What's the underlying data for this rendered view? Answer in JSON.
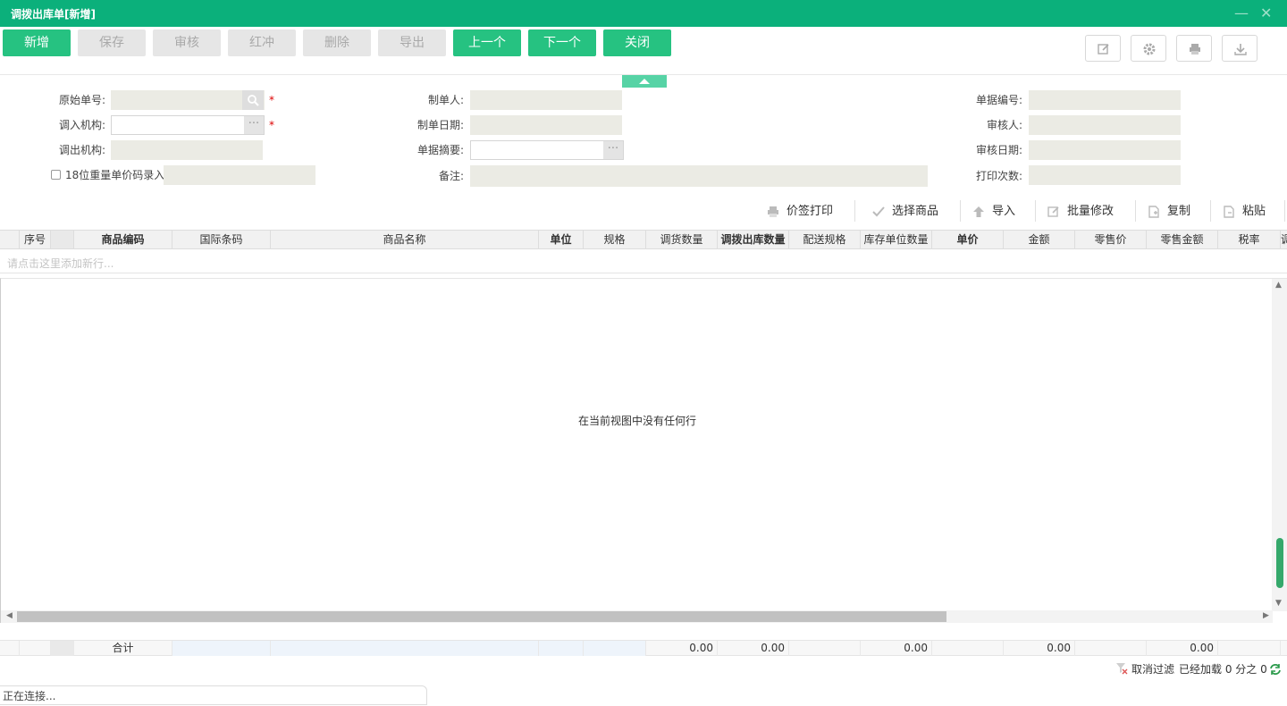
{
  "window": {
    "title": "调拨出库单[新增]"
  },
  "toolbar": {
    "buttons": [
      {
        "label": "新增",
        "enabled": true
      },
      {
        "label": "保存",
        "enabled": false
      },
      {
        "label": "审核",
        "enabled": false
      },
      {
        "label": "红冲",
        "enabled": false
      },
      {
        "label": "删除",
        "enabled": false
      },
      {
        "label": "导出",
        "enabled": false
      },
      {
        "label": "上一个",
        "enabled": true
      },
      {
        "label": "下一个",
        "enabled": true
      },
      {
        "label": "关闭",
        "enabled": true
      }
    ],
    "icon_buttons": [
      "edit-icon",
      "gear-icon",
      "print-icon",
      "download-icon"
    ]
  },
  "form": {
    "original_no_label": "原始单号:",
    "in_org_label": "调入机构:",
    "out_org_label": "调出机构:",
    "weight_code_label": "18位重量单价码录入",
    "maker_label": "制单人:",
    "make_date_label": "制单日期:",
    "summary_label": "单据摘要:",
    "remark_label": "备注:",
    "doc_no_label": "单据编号:",
    "auditor_label": "审核人:",
    "audit_date_label": "审核日期:",
    "print_count_label": "打印次数:",
    "required_mark": "*",
    "lookup_dots": "···"
  },
  "grid_tools": {
    "price_print": "价签打印",
    "select_goods": "选择商品",
    "import": "导入",
    "batch_edit": "批量修改",
    "copy": "复制",
    "paste": "粘贴"
  },
  "grid": {
    "columns": [
      "序号",
      "商品编码",
      "国际条码",
      "商品名称",
      "单位",
      "规格",
      "调货数量",
      "调拨出库数量",
      "配送规格",
      "库存单位数量",
      "单价",
      "金额",
      "零售价",
      "零售金额",
      "税率",
      "调"
    ],
    "add_row_hint": "请点击这里添加新行...",
    "empty_message": "在当前视图中没有任何行"
  },
  "footer": {
    "total_label": "合计",
    "qty_total": "0.00",
    "out_qty_total": "0.00",
    "stock_qty_total": "0.00",
    "amount_total": "0.00",
    "retail_amount_total": "0.00"
  },
  "status": {
    "cancel_filter": "取消过滤",
    "loaded": "已经加载 0 分之 0",
    "connecting": "正在连接..."
  }
}
